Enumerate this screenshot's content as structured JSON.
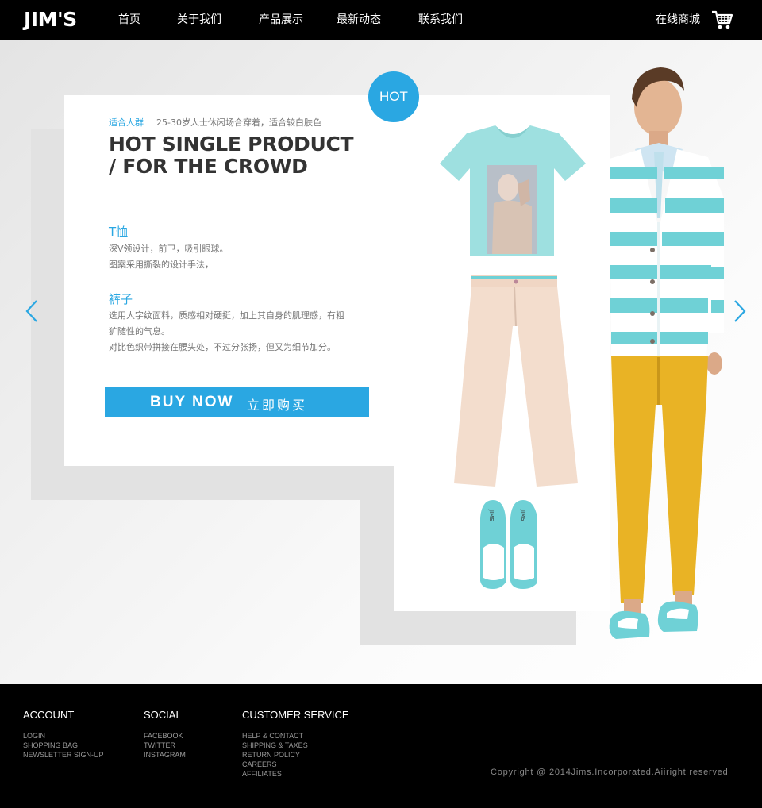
{
  "header": {
    "logo": "JIM'S",
    "nav": [
      "首页",
      "关于我们",
      "产品展示",
      "最新动态",
      "联系我们"
    ],
    "shop_label": "在线商城",
    "cart_icon": "shopping-cart-icon"
  },
  "hero": {
    "hot_badge": "HOT",
    "suitable_label": "适合人群",
    "suitable_text": "25-30岁人士休闲场合穿着，适合较白肤色",
    "headline": [
      "HOT SINGLE PRODUCT",
      "/ FOR THE CROWD"
    ],
    "features": [
      {
        "title": "T恤",
        "lines": [
          "深V领设计，前卫，吸引眼球。",
          "图案采用撕裂的设计手法，"
        ]
      },
      {
        "title": "裤子",
        "lines": [
          "选用人字纹面料，质感相对硬挺，加上其自身的肌理感，有粗",
          "犷随性的气息。",
          "对比色织带拼接在腰头处，不过分张扬，但又为细节加分。"
        ]
      }
    ],
    "buy_en": "BUY NOW",
    "buy_cn": "立即购买",
    "accent_color": "#2aa7e2",
    "prev_icon": "chevron-left-icon",
    "next_icon": "chevron-right-icon"
  },
  "footer": {
    "columns": [
      {
        "heading": "ACCOUNT",
        "links": [
          "LOGIN",
          "SHOPPING BAG",
          "NEWSLETTER SIGN-UP"
        ]
      },
      {
        "heading": "SOCIAL",
        "links": [
          "FACEBOOK",
          "TWITTER",
          "INSTAGRAM"
        ]
      },
      {
        "heading": "CUSTOMER SERVICE",
        "links": [
          "HELP & CONTACT",
          "SHIPPING & TAXES",
          "RETURN POLICY",
          "CAREERS",
          "AFFILIATES"
        ]
      }
    ],
    "copyright": "Copyright @ 2014Jims.Incorporated.Aiiright reserved"
  }
}
